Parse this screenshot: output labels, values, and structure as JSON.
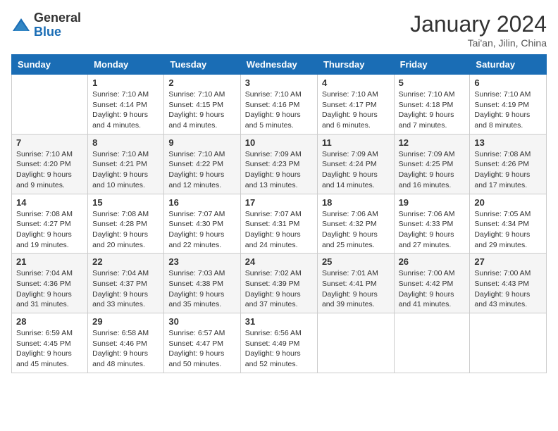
{
  "logo": {
    "general": "General",
    "blue": "Blue"
  },
  "header": {
    "month": "January 2024",
    "location": "Tai'an, Jilin, China"
  },
  "weekdays": [
    "Sunday",
    "Monday",
    "Tuesday",
    "Wednesday",
    "Thursday",
    "Friday",
    "Saturday"
  ],
  "weeks": [
    [
      {
        "day": "",
        "info": ""
      },
      {
        "day": "1",
        "info": "Sunrise: 7:10 AM\nSunset: 4:14 PM\nDaylight: 9 hours\nand 4 minutes."
      },
      {
        "day": "2",
        "info": "Sunrise: 7:10 AM\nSunset: 4:15 PM\nDaylight: 9 hours\nand 4 minutes."
      },
      {
        "day": "3",
        "info": "Sunrise: 7:10 AM\nSunset: 4:16 PM\nDaylight: 9 hours\nand 5 minutes."
      },
      {
        "day": "4",
        "info": "Sunrise: 7:10 AM\nSunset: 4:17 PM\nDaylight: 9 hours\nand 6 minutes."
      },
      {
        "day": "5",
        "info": "Sunrise: 7:10 AM\nSunset: 4:18 PM\nDaylight: 9 hours\nand 7 minutes."
      },
      {
        "day": "6",
        "info": "Sunrise: 7:10 AM\nSunset: 4:19 PM\nDaylight: 9 hours\nand 8 minutes."
      }
    ],
    [
      {
        "day": "7",
        "info": "Sunrise: 7:10 AM\nSunset: 4:20 PM\nDaylight: 9 hours\nand 9 minutes."
      },
      {
        "day": "8",
        "info": "Sunrise: 7:10 AM\nSunset: 4:21 PM\nDaylight: 9 hours\nand 10 minutes."
      },
      {
        "day": "9",
        "info": "Sunrise: 7:10 AM\nSunset: 4:22 PM\nDaylight: 9 hours\nand 12 minutes."
      },
      {
        "day": "10",
        "info": "Sunrise: 7:09 AM\nSunset: 4:23 PM\nDaylight: 9 hours\nand 13 minutes."
      },
      {
        "day": "11",
        "info": "Sunrise: 7:09 AM\nSunset: 4:24 PM\nDaylight: 9 hours\nand 14 minutes."
      },
      {
        "day": "12",
        "info": "Sunrise: 7:09 AM\nSunset: 4:25 PM\nDaylight: 9 hours\nand 16 minutes."
      },
      {
        "day": "13",
        "info": "Sunrise: 7:08 AM\nSunset: 4:26 PM\nDaylight: 9 hours\nand 17 minutes."
      }
    ],
    [
      {
        "day": "14",
        "info": "Sunrise: 7:08 AM\nSunset: 4:27 PM\nDaylight: 9 hours\nand 19 minutes."
      },
      {
        "day": "15",
        "info": "Sunrise: 7:08 AM\nSunset: 4:28 PM\nDaylight: 9 hours\nand 20 minutes."
      },
      {
        "day": "16",
        "info": "Sunrise: 7:07 AM\nSunset: 4:30 PM\nDaylight: 9 hours\nand 22 minutes."
      },
      {
        "day": "17",
        "info": "Sunrise: 7:07 AM\nSunset: 4:31 PM\nDaylight: 9 hours\nand 24 minutes."
      },
      {
        "day": "18",
        "info": "Sunrise: 7:06 AM\nSunset: 4:32 PM\nDaylight: 9 hours\nand 25 minutes."
      },
      {
        "day": "19",
        "info": "Sunrise: 7:06 AM\nSunset: 4:33 PM\nDaylight: 9 hours\nand 27 minutes."
      },
      {
        "day": "20",
        "info": "Sunrise: 7:05 AM\nSunset: 4:34 PM\nDaylight: 9 hours\nand 29 minutes."
      }
    ],
    [
      {
        "day": "21",
        "info": "Sunrise: 7:04 AM\nSunset: 4:36 PM\nDaylight: 9 hours\nand 31 minutes."
      },
      {
        "day": "22",
        "info": "Sunrise: 7:04 AM\nSunset: 4:37 PM\nDaylight: 9 hours\nand 33 minutes."
      },
      {
        "day": "23",
        "info": "Sunrise: 7:03 AM\nSunset: 4:38 PM\nDaylight: 9 hours\nand 35 minutes."
      },
      {
        "day": "24",
        "info": "Sunrise: 7:02 AM\nSunset: 4:39 PM\nDaylight: 9 hours\nand 37 minutes."
      },
      {
        "day": "25",
        "info": "Sunrise: 7:01 AM\nSunset: 4:41 PM\nDaylight: 9 hours\nand 39 minutes."
      },
      {
        "day": "26",
        "info": "Sunrise: 7:00 AM\nSunset: 4:42 PM\nDaylight: 9 hours\nand 41 minutes."
      },
      {
        "day": "27",
        "info": "Sunrise: 7:00 AM\nSunset: 4:43 PM\nDaylight: 9 hours\nand 43 minutes."
      }
    ],
    [
      {
        "day": "28",
        "info": "Sunrise: 6:59 AM\nSunset: 4:45 PM\nDaylight: 9 hours\nand 45 minutes."
      },
      {
        "day": "29",
        "info": "Sunrise: 6:58 AM\nSunset: 4:46 PM\nDaylight: 9 hours\nand 48 minutes."
      },
      {
        "day": "30",
        "info": "Sunrise: 6:57 AM\nSunset: 4:47 PM\nDaylight: 9 hours\nand 50 minutes."
      },
      {
        "day": "31",
        "info": "Sunrise: 6:56 AM\nSunset: 4:49 PM\nDaylight: 9 hours\nand 52 minutes."
      },
      {
        "day": "",
        "info": ""
      },
      {
        "day": "",
        "info": ""
      },
      {
        "day": "",
        "info": ""
      }
    ]
  ]
}
